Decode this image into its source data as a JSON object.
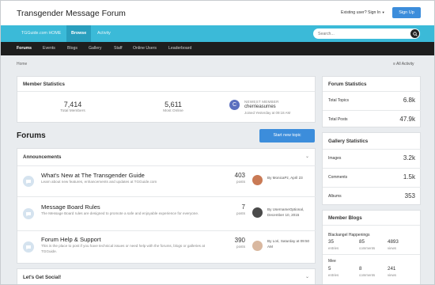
{
  "header": {
    "site_title": "Transgender Message Forum",
    "signin_label": "Existing user? Sign In",
    "signup_label": "Sign Up"
  },
  "primary_nav": {
    "items": [
      {
        "label": "TGGuide.com HOME"
      },
      {
        "label": "Browse"
      },
      {
        "label": "Activity"
      }
    ],
    "active_item": "Browse"
  },
  "search": {
    "placeholder": "Search..."
  },
  "secondary_nav": {
    "items": [
      {
        "label": "Forums"
      },
      {
        "label": "Events"
      },
      {
        "label": "Blogs"
      },
      {
        "label": "Gallery"
      },
      {
        "label": "Staff"
      },
      {
        "label": "Online Users"
      },
      {
        "label": "Leaderboard"
      }
    ],
    "active_item": "Forums"
  },
  "breadcrumb": {
    "home": "Home",
    "all_activity": "All Activity"
  },
  "member_statistics": {
    "title": "Member Statistics",
    "total_members_value": "7,414",
    "total_members_label": "Total Members",
    "most_online_value": "5,611",
    "most_online_label": "Most Online",
    "newest_member_label": "NEWEST MEMBER",
    "newest_member_name": "cherrieasurnes",
    "newest_member_joined": "Joined Yesterday at 09:18 AM",
    "newest_member_initial": "C"
  },
  "forums": {
    "heading": "Forums",
    "start_topic_label": "Start new topic",
    "sections": [
      {
        "title": "Announcements",
        "forums": [
          {
            "title": "What's New at The Transgender Guide",
            "description": "Learn about new features, enhancements and updates at TGGuide.com",
            "posts": "403",
            "posts_label": "posts",
            "last_by": "By MonicaPz, April 23"
          },
          {
            "title": "Message Board Rules",
            "description": "The Message Board rules are designed to promote a safe and enjoyable experience for everyone.",
            "posts": "7",
            "posts_label": "posts",
            "last_by": "By UsernameOptional, December 10, 2015"
          },
          {
            "title": "Forum Help & Support",
            "description": "This is the place to post if you have technical issues or need help with the forums, blogs or galleries at TGGuide.",
            "posts": "390",
            "posts_label": "posts",
            "last_by": "By Lori, Saturday at 09:50 AM"
          }
        ]
      },
      {
        "title": "Let's Get Social!"
      }
    ]
  },
  "forum_statistics": {
    "title": "Forum Statistics",
    "rows": [
      {
        "label": "Total Topics",
        "value": "6.8k"
      },
      {
        "label": "Total Posts",
        "value": "47.9k"
      }
    ]
  },
  "gallery_statistics": {
    "title": "Gallery Statistics",
    "rows": [
      {
        "label": "Images",
        "value": "3.2k"
      },
      {
        "label": "Comments",
        "value": "1.5k"
      },
      {
        "label": "Albums",
        "value": "353"
      }
    ]
  },
  "member_blogs": {
    "title": "Member Blogs",
    "blogs": [
      {
        "title": "Blackangel Happenings",
        "entries": "35",
        "entries_label": "entries",
        "comments": "85",
        "comments_label": "comments",
        "views": "4893",
        "views_label": "views"
      },
      {
        "title": "Mee",
        "entries": "5",
        "entries_label": "entries",
        "comments": "8",
        "comments_label": "comments",
        "views": "241",
        "views_label": "views"
      }
    ]
  },
  "colors": {
    "primary_nav_bg": "#3bbad8",
    "secondary_nav_bg": "#1e1e1e",
    "accent_button": "#3c8ddb"
  }
}
